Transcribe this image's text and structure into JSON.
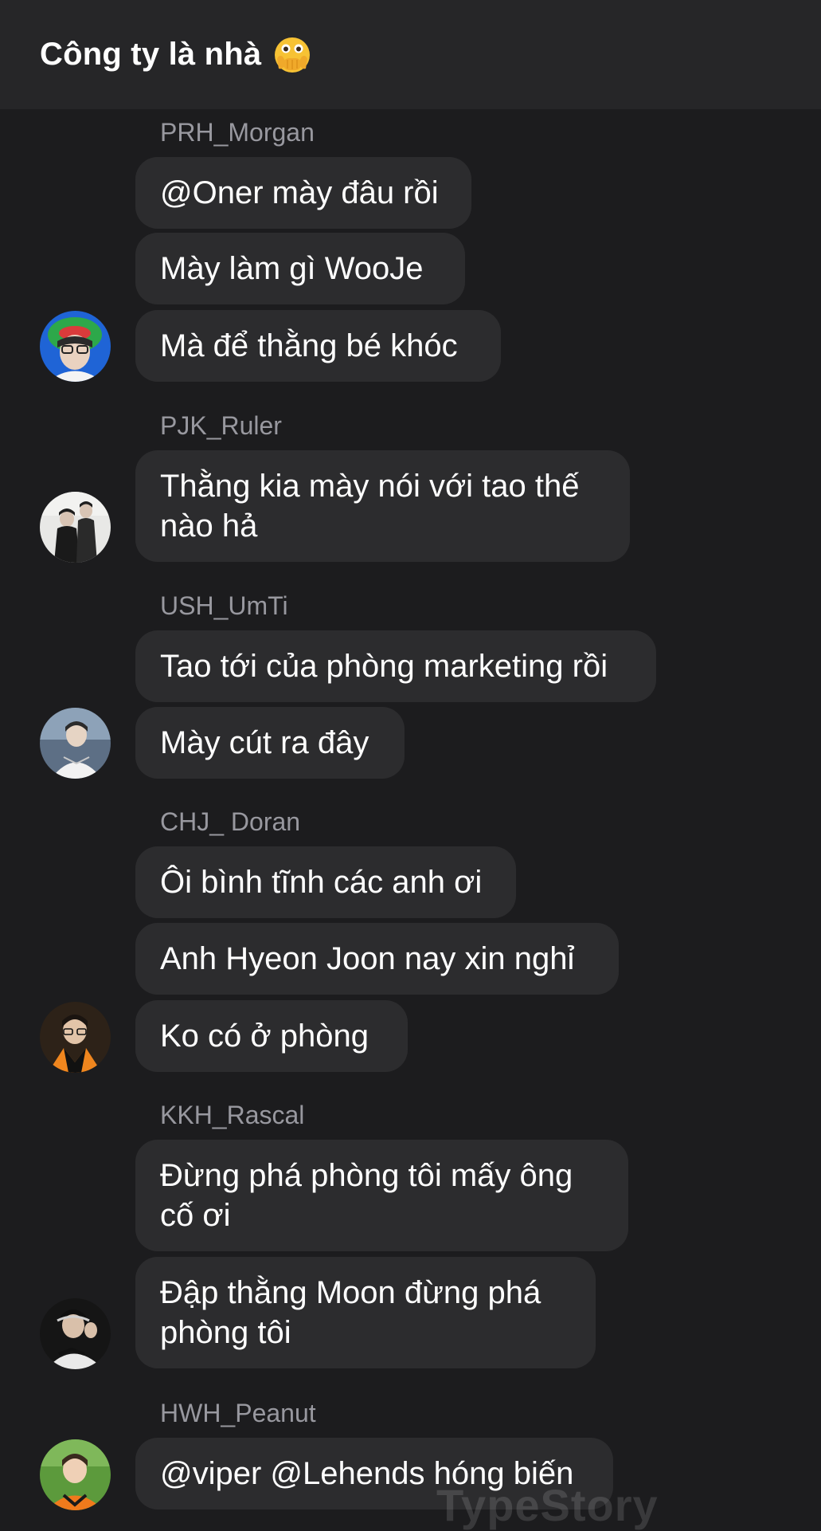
{
  "header": {
    "title": "Công ty là nhà",
    "emoji_icon": "face-with-open-eyes-and-hand-over-mouth-icon"
  },
  "messages": [
    {
      "sender": "PRH_Morgan",
      "lines": [
        "@Oner mày đâu rồi",
        "Mày làm gì WooJe",
        "Mà để thằng bé khóc"
      ]
    },
    {
      "sender": "PJK_Ruler",
      "lines": [
        "Thằng kia mày nói với tao thế nào hả"
      ]
    },
    {
      "sender": "USH_UmTi",
      "lines": [
        "Tao tới của phòng marketing rồi",
        "Mày cút ra đây"
      ]
    },
    {
      "sender": "CHJ_ Doran",
      "lines": [
        "Ôi bình tĩnh các anh ơi",
        "Anh Hyeon Joon nay xin nghỉ",
        "Ko có ở phòng"
      ]
    },
    {
      "sender": "KKH_Rascal",
      "lines": [
        "Đừng phá phòng tôi mấy ông cố ơi",
        "Đập thằng Moon đừng phá phòng tôi"
      ]
    },
    {
      "sender": "HWH_Peanut",
      "lines": [
        "@viper @Lehends hóng biến"
      ]
    }
  ],
  "watermark": "TypeStory",
  "colors": {
    "background": "#1c1c1e",
    "header": "#262628",
    "bubble": "#2c2c2e",
    "sender_name": "#98989f",
    "text": "#ffffff"
  }
}
